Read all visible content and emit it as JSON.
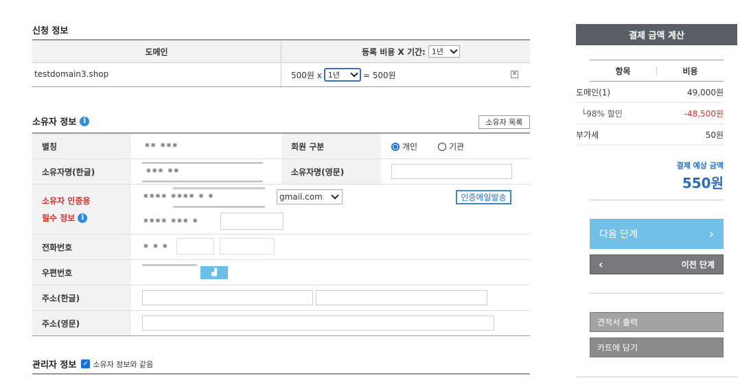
{
  "application": {
    "title": "신청 정보",
    "col_domain": "도메인",
    "col_cost": "등록 비용 X 기간:",
    "period_default": "1년",
    "domain": "testdomain3.shop",
    "unit_price": "500원 x",
    "period": "1년",
    "total": "= 500원"
  },
  "owner": {
    "title": "소유자 정보",
    "list_button": "소유자 목록",
    "rows": {
      "alias": "별칭",
      "member_type": "회원 구분",
      "type_personal": "개인",
      "type_org": "기관",
      "name_kr": "소유자명(한글)",
      "name_en": "소유자명(영문)",
      "auth_line1": "소유자 인증용",
      "auth_line2": "필수 정보",
      "email_domain": "gmail.com",
      "send_auth_mail": "인증메일발송",
      "phone": "전화번호",
      "postcode": "우편번호",
      "address_kr": "주소(한글)",
      "address_en": "주소(영문)"
    }
  },
  "admin": {
    "title": "관리자 정보",
    "same_as_owner": "소유자 정보와 같음"
  },
  "summary": {
    "title": "결제 금액 계산",
    "col_item": "항목",
    "col_cost": "비용",
    "domain_label": "도메인(1)",
    "domain_cost": "49,000원",
    "discount_label": "└98% 할인",
    "discount_cost": "-48,500원",
    "vat_label": "부가세",
    "vat_cost": "50원",
    "expected_label": "결제 예상 금액",
    "expected_amount": "550원",
    "next_button": "다음 단계",
    "prev_button": "이전 단계",
    "estimate_button": "견적서 출력",
    "cart_button": "카트에 담기"
  },
  "colors": {
    "accent": "#2f8fd8",
    "negative": "#d0302c",
    "next_button": "#72bfe8",
    "panel_header": "#5a5e66"
  }
}
